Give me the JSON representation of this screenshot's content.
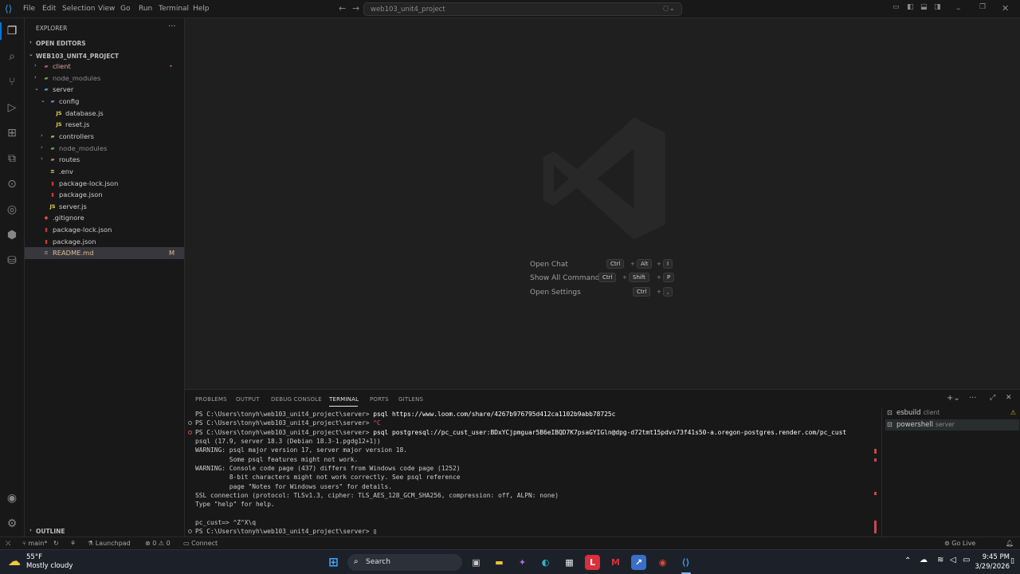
{
  "titlebar": {
    "menus": [
      "File",
      "Edit",
      "Selection",
      "View",
      "Go",
      "Run",
      "Terminal",
      "Help"
    ],
    "search_text": "web103_unit4_project"
  },
  "sidebar": {
    "header": "EXPLORER",
    "open_editors": "OPEN EDITORS",
    "project": "WEB103_UNIT4_PROJECT",
    "outline": "OUTLINE",
    "tree": [
      {
        "label": "client",
        "indent": 1,
        "type": "folder",
        "chev": "›",
        "color": "#c05a7a",
        "status": "•"
      },
      {
        "label": "node_modules",
        "indent": 1,
        "type": "folder",
        "chev": "›",
        "color": "#6aaa55",
        "status": ""
      },
      {
        "label": "server",
        "indent": 1,
        "type": "folder",
        "chev": "⌄",
        "color": "#4e9fd0",
        "status": ""
      },
      {
        "label": "config",
        "indent": 2,
        "type": "folder",
        "chev": "⌄",
        "color": "#5d8fc9",
        "status": ""
      },
      {
        "label": "database.js",
        "indent": 3,
        "type": "js",
        "chev": "",
        "color": "#e8d44d",
        "status": ""
      },
      {
        "label": "reset.js",
        "indent": 3,
        "type": "js",
        "chev": "",
        "color": "#e8d44d",
        "status": ""
      },
      {
        "label": "controllers",
        "indent": 2,
        "type": "folder",
        "chev": "›",
        "color": "#c9a45d",
        "status": ""
      },
      {
        "label": "node_modules",
        "indent": 2,
        "type": "folder",
        "chev": "›",
        "color": "#6aaa55",
        "status": ""
      },
      {
        "label": "routes",
        "indent": 2,
        "type": "folder",
        "chev": "›",
        "color": "#c9825d",
        "status": ""
      },
      {
        "label": ".env",
        "indent": 2,
        "type": "env",
        "chev": "",
        "color": "#e8d44d",
        "status": ""
      },
      {
        "label": "package-lock.json",
        "indent": 2,
        "type": "npm",
        "chev": "",
        "color": "#cb3837",
        "status": ""
      },
      {
        "label": "package.json",
        "indent": 2,
        "type": "npm",
        "chev": "",
        "color": "#cb3837",
        "status": ""
      },
      {
        "label": "server.js",
        "indent": 2,
        "type": "js",
        "chev": "",
        "color": "#e8d44d",
        "status": ""
      },
      {
        "label": ".gitignore",
        "indent": 1,
        "type": "git",
        "chev": "",
        "color": "#e04e39",
        "status": ""
      },
      {
        "label": "package-lock.json",
        "indent": 1,
        "type": "npm",
        "chev": "",
        "color": "#cb3837",
        "status": ""
      },
      {
        "label": "package.json",
        "indent": 1,
        "type": "npm",
        "chev": "",
        "color": "#cb3837",
        "status": ""
      },
      {
        "label": "README.md",
        "indent": 1,
        "type": "md",
        "chev": "",
        "color": "#8a8a8a",
        "status": "M"
      }
    ]
  },
  "editor": {
    "hints": [
      {
        "label": "Open Chat",
        "keys": [
          "Ctrl",
          "Alt",
          "I"
        ]
      },
      {
        "label": "Show All Commands",
        "keys": [
          "Ctrl",
          "Shift",
          "P"
        ]
      },
      {
        "label": "Open Settings",
        "keys": [
          "Ctrl",
          ","
        ]
      }
    ]
  },
  "panel": {
    "tabs": [
      "PROBLEMS",
      "OUTPUT",
      "DEBUG CONSOLE",
      "TERMINAL",
      "PORTS",
      "GITLENS"
    ],
    "active_tab": "TERMINAL",
    "terminal_lines": [
      {
        "prompt": "PS C:\\Users\\tonyh\\web103_unit4_project\\server> ",
        "cmd": "psql https://www.loom.com/share/4267b976795d412ca1102b9abb78725c",
        "dot": ""
      },
      {
        "prompt": "PS C:\\Users\\tonyh\\web103_unit4_project\\server> ",
        "cmd": "^C",
        "dot": "#8a8a8a"
      },
      {
        "prompt": "PS C:\\Users\\tonyh\\web103_unit4_project\\server> ",
        "cmd": "psql postgresql://pc_cust_user:BDxYCjpmguar5B6eIBQD7K7psaGYIGln@dpg-d72tmt15pdvs73f41s50-a.oregon-postgres.render.com/pc_cust",
        "dot": "#d04a4a"
      },
      {
        "prompt": "psql (17.9, server 18.3 (Debian 18.3-1.pgdg12+1))",
        "cmd": "",
        "dot": ""
      },
      {
        "prompt": "WARNING: psql major version 17, server major version 18.",
        "cmd": "",
        "dot": ""
      },
      {
        "prompt": "         Some psql features might not work.",
        "cmd": "",
        "dot": ""
      },
      {
        "prompt": "WARNING: Console code page (437) differs from Windows code page (1252)",
        "cmd": "",
        "dot": ""
      },
      {
        "prompt": "         8-bit characters might not work correctly. See psql reference",
        "cmd": "",
        "dot": ""
      },
      {
        "prompt": "         page \"Notes for Windows users\" for details.",
        "cmd": "",
        "dot": ""
      },
      {
        "prompt": "SSL connection (protocol: TLSv1.3, cipher: TLS_AES_128_GCM_SHA256, compression: off, ALPN: none)",
        "cmd": "",
        "dot": ""
      },
      {
        "prompt": "Type \"help\" for help.",
        "cmd": "",
        "dot": ""
      },
      {
        "prompt": "",
        "cmd": "",
        "dot": ""
      },
      {
        "prompt": "pc_cust=> ^Z^X\\q",
        "cmd": "",
        "dot": ""
      },
      {
        "prompt": "PS C:\\Users\\tonyh\\web103_unit4_project\\server> ",
        "cmd": "▯",
        "dot": "#8a8a8a"
      }
    ],
    "terminals": [
      {
        "name": "esbuild",
        "sub": "client"
      },
      {
        "name": "powershell",
        "sub": "server"
      }
    ]
  },
  "statusbar": {
    "branch": "main*",
    "launchpad": "Launchpad",
    "problems": "⊗ 0 ⚠ 0",
    "connect": "Connect",
    "golive": "Go Live"
  },
  "taskbar": {
    "weather_temp": "55°F",
    "weather_desc": "Mostly cloudy",
    "search": "Search",
    "time": "9:45 PM",
    "date": "3/29/2026"
  }
}
